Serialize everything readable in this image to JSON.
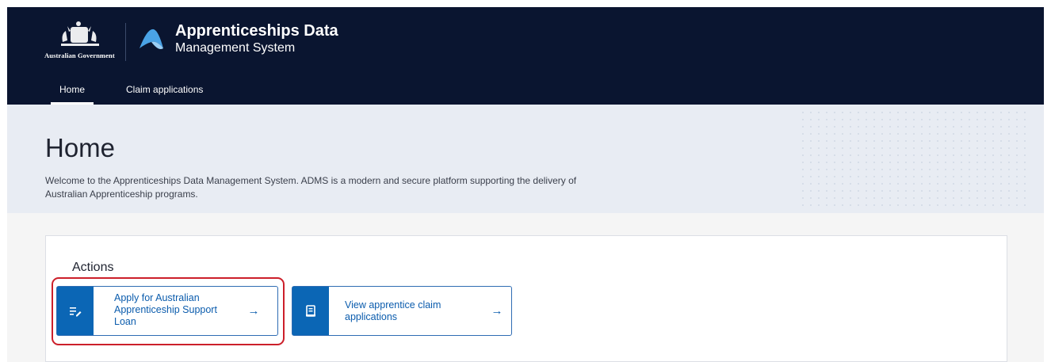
{
  "header": {
    "government_text": "Australian Government",
    "app_title_line1": "Apprenticeships Data",
    "app_title_line2": "Management System"
  },
  "nav": {
    "tabs": [
      {
        "label": "Home",
        "active": true
      },
      {
        "label": "Claim applications",
        "active": false
      }
    ]
  },
  "hero": {
    "title": "Home",
    "intro": "Welcome to the Apprenticeships Data Management System. ADMS is a modern and secure platform supporting the delivery of Australian Apprenticeship programs."
  },
  "actions": {
    "heading": "Actions",
    "cards": [
      {
        "label": "Apply for Australian Apprenticeship Support Loan",
        "icon": "edit-list-icon",
        "arrow": "→"
      },
      {
        "label": "View apprentice claim applications",
        "icon": "document-icon",
        "arrow": "→"
      }
    ]
  },
  "colors": {
    "header_bg": "#0a1530",
    "hero_bg": "#e8ecf3",
    "accent": "#0b66b5",
    "link": "#0b5cad",
    "highlight": "#cc1f2a"
  }
}
